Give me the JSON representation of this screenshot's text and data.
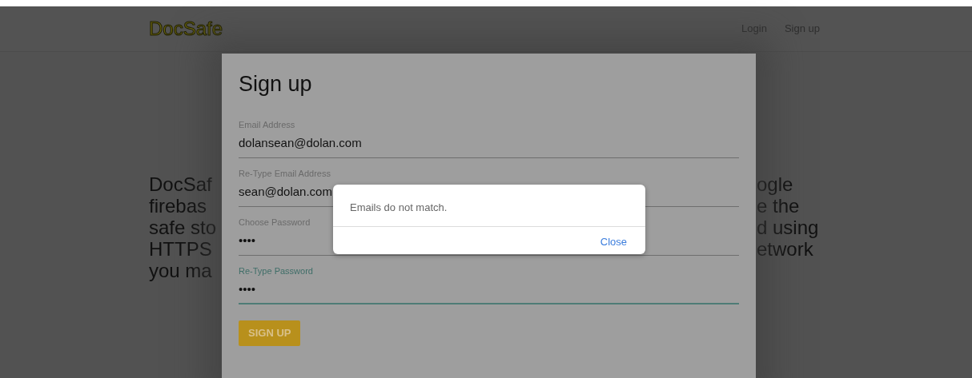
{
  "header": {
    "logo": "DocSafe",
    "nav": [
      {
        "label": "Login"
      },
      {
        "label": "Sign up"
      }
    ]
  },
  "background_text": {
    "left": [
      "DocSaf",
      "firebas",
      "safe sto",
      "HTTPS",
      "you ma"
    ],
    "right": [
      "ogle",
      "e the",
      "d using",
      "etwork"
    ]
  },
  "signup_form": {
    "title": "Sign up",
    "fields": [
      {
        "label": "Email Address",
        "value": "dolansean@dolan.com",
        "focused": false
      },
      {
        "label": "Re-Type Email Address",
        "value": "sean@dolan.com",
        "focused": false
      },
      {
        "label": "Choose Password",
        "value": "••••",
        "focused": false
      },
      {
        "label": "Re-Type Password",
        "value": "••••",
        "focused": true
      }
    ],
    "submit": "SIGN UP"
  },
  "alert": {
    "message": "Emails do not match.",
    "button": "Close"
  }
}
